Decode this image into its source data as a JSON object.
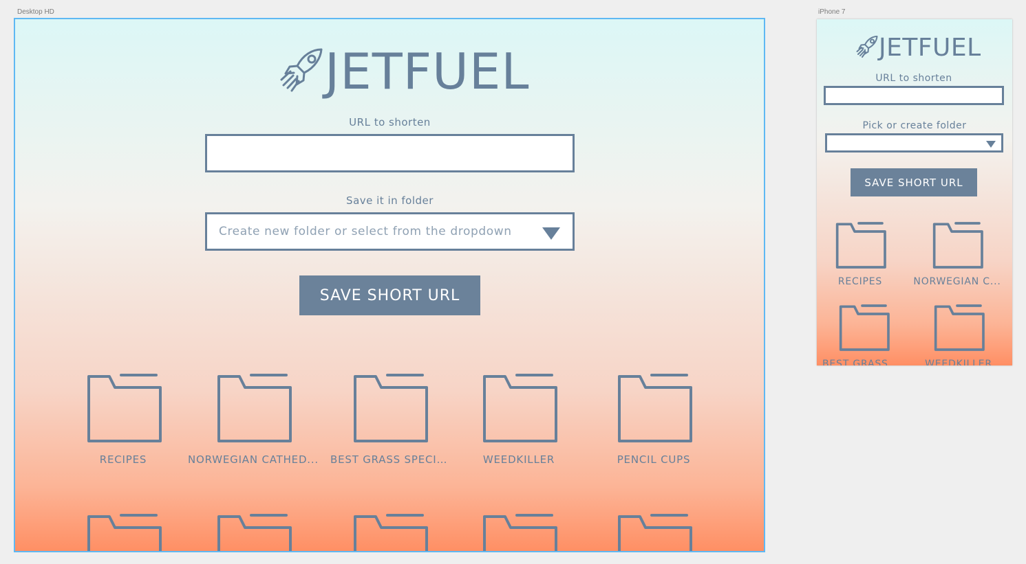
{
  "artboards": {
    "desktop_label": "Desktop HD",
    "phone_label": "iPhone 7"
  },
  "app": {
    "logo_text": "JETFUEL",
    "logo_icon": "rocket-icon"
  },
  "desktop": {
    "url_label": "URL to shorten",
    "url_value": "",
    "folder_label": "Save it in folder",
    "folder_placeholder": "Create new folder or select from the dropdown",
    "save_button": "SAVE SHORT URL",
    "folders": [
      "RECIPES",
      "NORWEGIAN CATHED...",
      "BEST GRASS SPECIES",
      "WEEDKILLER",
      "PENCIL CUPS"
    ]
  },
  "phone": {
    "url_label": "URL to shorten",
    "url_value": "",
    "folder_label": "Pick or create folder",
    "save_button": "SAVE SHORT URL",
    "folders": [
      "RECIPES",
      "NORWEGIAN C...",
      "BEST GRASS SP...",
      "WEEDKILLER"
    ]
  },
  "colors": {
    "accent": "#67809a",
    "button": "#6b829a",
    "selection": "#5eb8f3",
    "gradient_top": "#dcf7f6",
    "gradient_bottom": "#ff8f64"
  }
}
